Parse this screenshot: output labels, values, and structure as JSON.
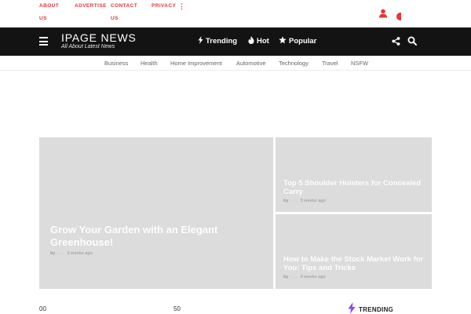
{
  "topbar": {
    "links": [
      {
        "line1": "ABOUT",
        "line2": "US"
      },
      {
        "line1": "ADVERTISE",
        "line2": ""
      },
      {
        "line1": "CONTACT",
        "line2": "US"
      },
      {
        "line1": "PRIVACY",
        "line2": ""
      }
    ],
    "more_glyph": "⋮",
    "accent_color": "#e8343b"
  },
  "header": {
    "logo": "IPAGE NEWS",
    "tagline": "All About Latest News",
    "nav": [
      {
        "label": "Trending",
        "icon": "bolt-icon"
      },
      {
        "label": "Hot",
        "icon": "flame-icon"
      },
      {
        "label": "Popular",
        "icon": "star-icon"
      }
    ],
    "background": "#131313"
  },
  "categories": [
    "Business",
    "Health",
    "Home Improvement",
    "Automotive",
    "Technology",
    "Travel",
    "NSFW"
  ],
  "featured": {
    "main": {
      "title": "Grow Your Garden with an Elegant Greenhouse!",
      "by": "by",
      "author": "......",
      "time": "2 weeks ago"
    },
    "side": [
      {
        "title": "Top 5 Shoulder Holsters for Concealed Carry",
        "by": "by",
        "author": "......",
        "time": "3 weeks ago"
      },
      {
        "title": "How to Make the Stock Market Work for You: Tips and Tricks",
        "by": "by",
        "author": "......",
        "time": "4 weeks ago"
      }
    ]
  },
  "bottom": {
    "num_left": "00",
    "num_mid": "50",
    "trending_label": "TRENDING",
    "trending_color": "#8e44ec"
  }
}
